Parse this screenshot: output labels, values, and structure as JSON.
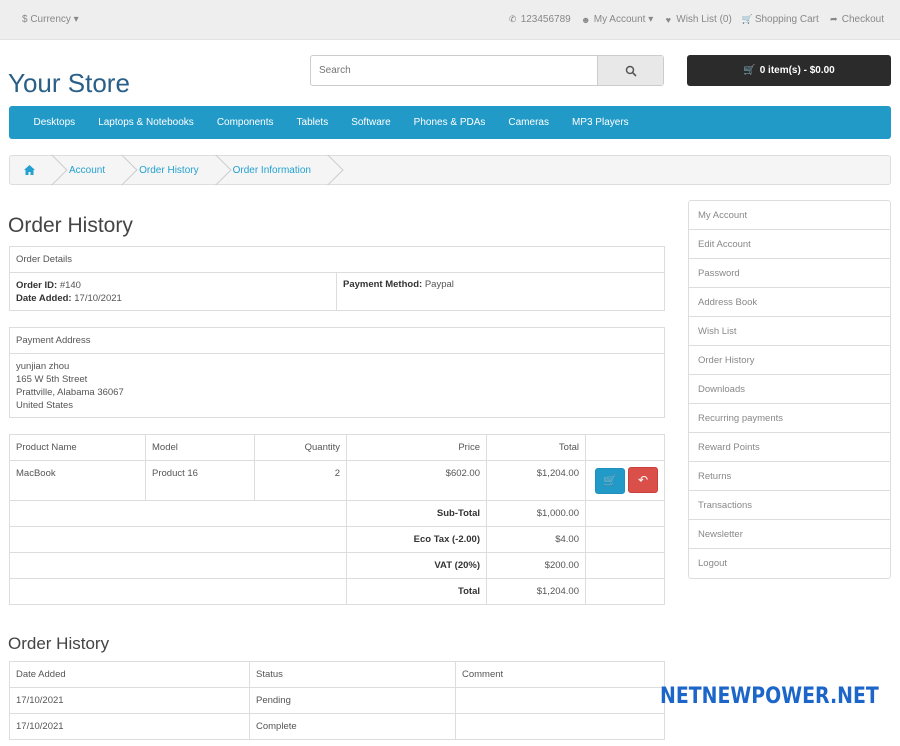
{
  "topbar": {
    "currency": "$ Currency ▾",
    "phone": "123456789",
    "my_account": "My Account ▾",
    "wish_list": "Wish List (0)",
    "shopping_cart": "Shopping Cart",
    "checkout": "Checkout"
  },
  "header": {
    "logo": "Your Store",
    "search_placeholder": "Search",
    "cart_label": "0 item(s) - $0.00"
  },
  "menu": [
    "Desktops",
    "Laptops & Notebooks",
    "Components",
    "Tablets",
    "Software",
    "Phones & PDAs",
    "Cameras",
    "MP3 Players"
  ],
  "breadcrumb": [
    "Account",
    "Order History",
    "Order Information"
  ],
  "page_title": "Order History",
  "order_details": {
    "heading": "Order Details",
    "order_id_label": "Order ID:",
    "order_id": "#140",
    "date_added_label": "Date Added:",
    "date_added": "17/10/2021",
    "payment_method_label": "Payment Method:",
    "payment_method": "Paypal"
  },
  "payment_address": {
    "heading": "Payment Address",
    "lines": [
      "yunjian zhou",
      "165 W 5th Street",
      "Prattville, Alabama 36067",
      "United States"
    ]
  },
  "products": {
    "headers": [
      "Product Name",
      "Model",
      "Quantity",
      "Price",
      "Total"
    ],
    "rows": [
      {
        "name": "MacBook",
        "model": "Product 16",
        "quantity": "2",
        "price": "$602.00",
        "total": "$1,204.00"
      }
    ],
    "totals": [
      {
        "label": "Sub-Total",
        "value": "$1,000.00"
      },
      {
        "label": "Eco Tax (-2.00)",
        "value": "$4.00"
      },
      {
        "label": "VAT (20%)",
        "value": "$200.00"
      },
      {
        "label": "Total",
        "value": "$1,204.00"
      }
    ]
  },
  "history": {
    "heading": "Order History",
    "headers": [
      "Date Added",
      "Status",
      "Comment"
    ],
    "rows": [
      {
        "date": "17/10/2021",
        "status": "Pending",
        "comment": ""
      },
      {
        "date": "17/10/2021",
        "status": "Complete",
        "comment": ""
      }
    ]
  },
  "sidebar": [
    "My Account",
    "Edit Account",
    "Password",
    "Address Book",
    "Wish List",
    "Order History",
    "Downloads",
    "Recurring payments",
    "Reward Points",
    "Returns",
    "Transactions",
    "Newsletter",
    "Logout"
  ],
  "watermark": "NETNEWPOWER.NET",
  "colors": {
    "accent": "#229ac8",
    "danger": "#da4f49",
    "cart_bg": "#2b2b2b"
  }
}
